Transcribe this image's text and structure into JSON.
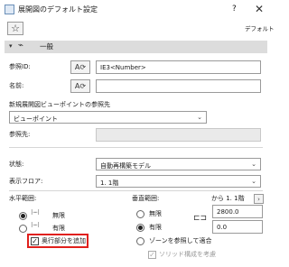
{
  "title": "展開図のデフォルト設定",
  "help_label": "?",
  "close_label": "✕",
  "favorites_icon": "☆",
  "default_label": "デフォルト",
  "section": {
    "label": "一般"
  },
  "ref_id": {
    "label": "参照ID:",
    "value": "IE3<Number>"
  },
  "name": {
    "label": "名前:",
    "value": ""
  },
  "viewpoint": {
    "label": "新規展開図ビューポイントの参照先",
    "selected": "ビューポイント"
  },
  "ref_dest": {
    "label": "参照先:",
    "value": ""
  },
  "status": {
    "label": "状態:",
    "selected": "自動再構築モデル"
  },
  "display_floor": {
    "label": "表示フロア:",
    "selected": "1. 1階"
  },
  "horizontal": {
    "label": "水平範囲:",
    "options": [
      "無限",
      "有限"
    ],
    "selected_index": 0,
    "checkbox_label": "奥行部分を追加",
    "checkbox_checked": true
  },
  "vertical": {
    "label": "垂直範囲:",
    "from_label": "から 1. 1階",
    "options": [
      "無限",
      "有限",
      "ゾーンを参照して適合"
    ],
    "selected_index": 1,
    "top_value": "2800.0",
    "bottom_value": "0.0",
    "solid_label": "ソリッド構成を考慮"
  }
}
